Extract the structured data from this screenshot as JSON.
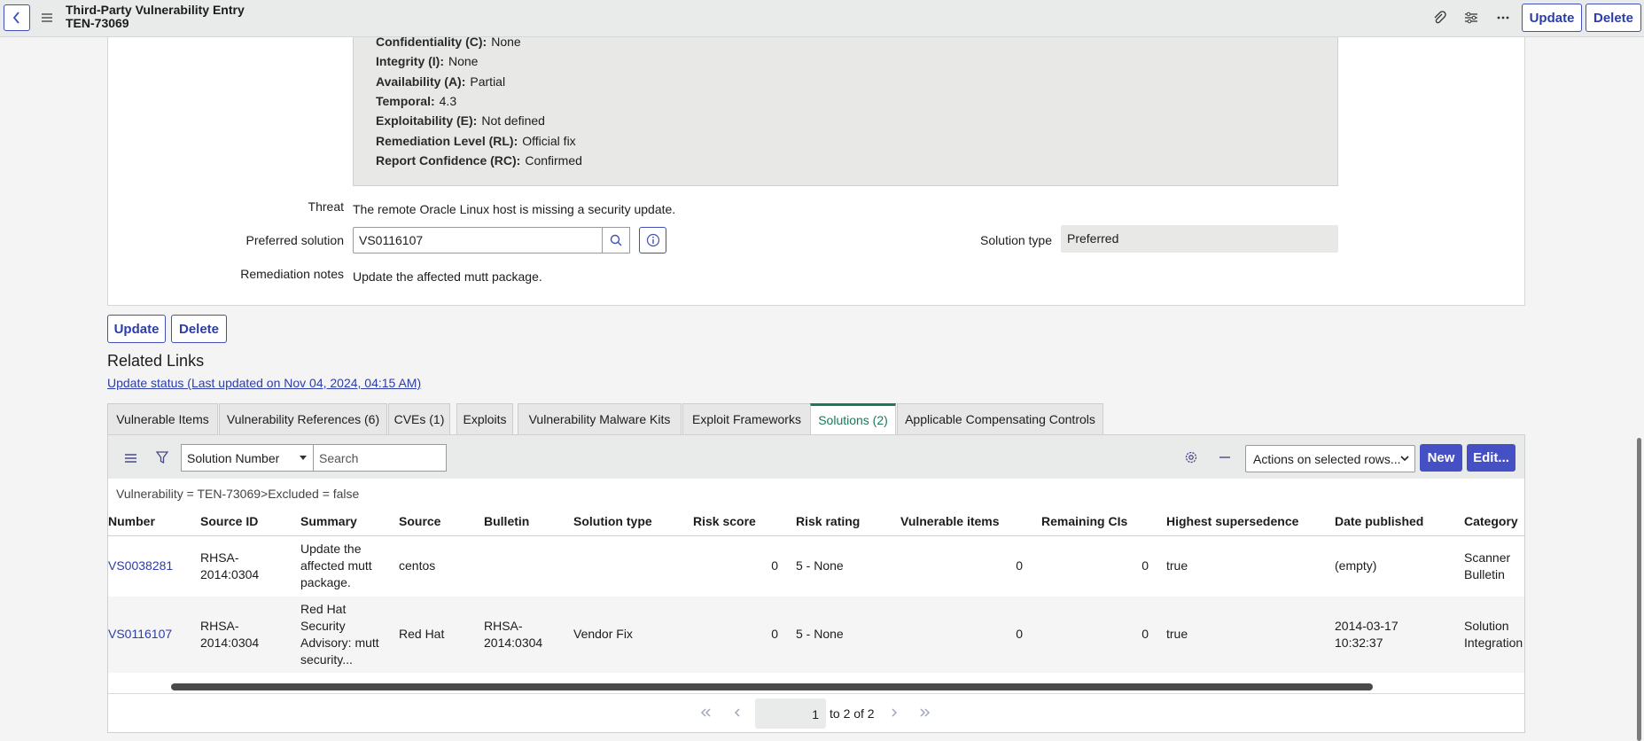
{
  "header": {
    "title_line1": "Third-Party Vulnerability Entry",
    "title_line2": "TEN-73069",
    "update_label": "Update",
    "delete_label": "Delete"
  },
  "cvss": [
    {
      "key": "Confidentiality (C):",
      "value": "None"
    },
    {
      "key": "Integrity (I):",
      "value": "None"
    },
    {
      "key": "Availability (A):",
      "value": "Partial"
    },
    {
      "key": "Temporal:",
      "value": "4.3"
    },
    {
      "key": "Exploitability (E):",
      "value": "Not defined"
    },
    {
      "key": "Remediation Level (RL):",
      "value": "Official fix"
    },
    {
      "key": "Report Confidence (RC):",
      "value": "Confirmed"
    }
  ],
  "form": {
    "threat_label": "Threat",
    "threat_value": "The remote Oracle Linux host is missing a security update.",
    "preferred_solution_label": "Preferred solution",
    "preferred_solution_value": "VS0116107",
    "solution_type_label": "Solution type",
    "solution_type_value": "Preferred",
    "remediation_notes_label": "Remediation notes",
    "remediation_notes_value": "Update the affected mutt package."
  },
  "bottom_buttons": {
    "update": "Update",
    "delete": "Delete"
  },
  "related": {
    "title": "Related Links",
    "update_link": "Update status (Last updated on Nov 04, 2024, 04:15 AM)"
  },
  "tabs": [
    "Vulnerable Items",
    "Vulnerability References (6)",
    "CVEs (1)",
    "Exploits",
    "Vulnerability Malware Kits",
    "Exploit Frameworks",
    "Solutions (2)",
    "Applicable Compensating Controls"
  ],
  "list": {
    "select_value": "Solution Number",
    "search_placeholder": "Search",
    "actions_select": "Actions on selected rows...",
    "new_label": "New",
    "edit_label": "Edit...",
    "filter": "Vulnerability = TEN-73069>Excluded = false",
    "columns": [
      "Number",
      "Source ID",
      "Summary",
      "Source",
      "Bulletin",
      "Solution type",
      "Risk score",
      "Risk rating",
      "Vulnerable items",
      "Remaining CIs",
      "Highest supersedence",
      "Date published",
      "Category"
    ],
    "rows": [
      {
        "number": "VS0038281",
        "source_id_1": "RHSA-",
        "source_id_2": "2014:0304",
        "summary_1": "Update the",
        "summary_2": "affected mutt",
        "summary_3": "package.",
        "source": "centos",
        "bulletin_1": "",
        "bulletin_2": "",
        "solution_type": "",
        "risk_score": "0",
        "risk_rating": "5 - None",
        "vulnerable_items": "0",
        "remaining_cis": "0",
        "highest_supersedence": "true",
        "date_1": "(empty)",
        "date_2": "",
        "category_1": "Scanner",
        "category_2": "Bulletin"
      },
      {
        "number": "VS0116107",
        "source_id_1": "RHSA-",
        "source_id_2": "2014:0304",
        "summary_1": "Red Hat",
        "summary_2": "Security",
        "summary_3": "Advisory: mutt",
        "summary_4": "security...",
        "source": "Red Hat",
        "bulletin_1": "RHSA-",
        "bulletin_2": "2014:0304",
        "solution_type": "Vendor Fix",
        "risk_score": "0",
        "risk_rating": "5 - None",
        "vulnerable_items": "0",
        "remaining_cis": "0",
        "highest_supersedence": "true",
        "date_1": "2014-03-17",
        "date_2": "10:32:37",
        "category_1": "Solution",
        "category_2": "Integration"
      }
    ]
  },
  "pager": {
    "page": "1",
    "range_text": "to 2 of 2"
  }
}
